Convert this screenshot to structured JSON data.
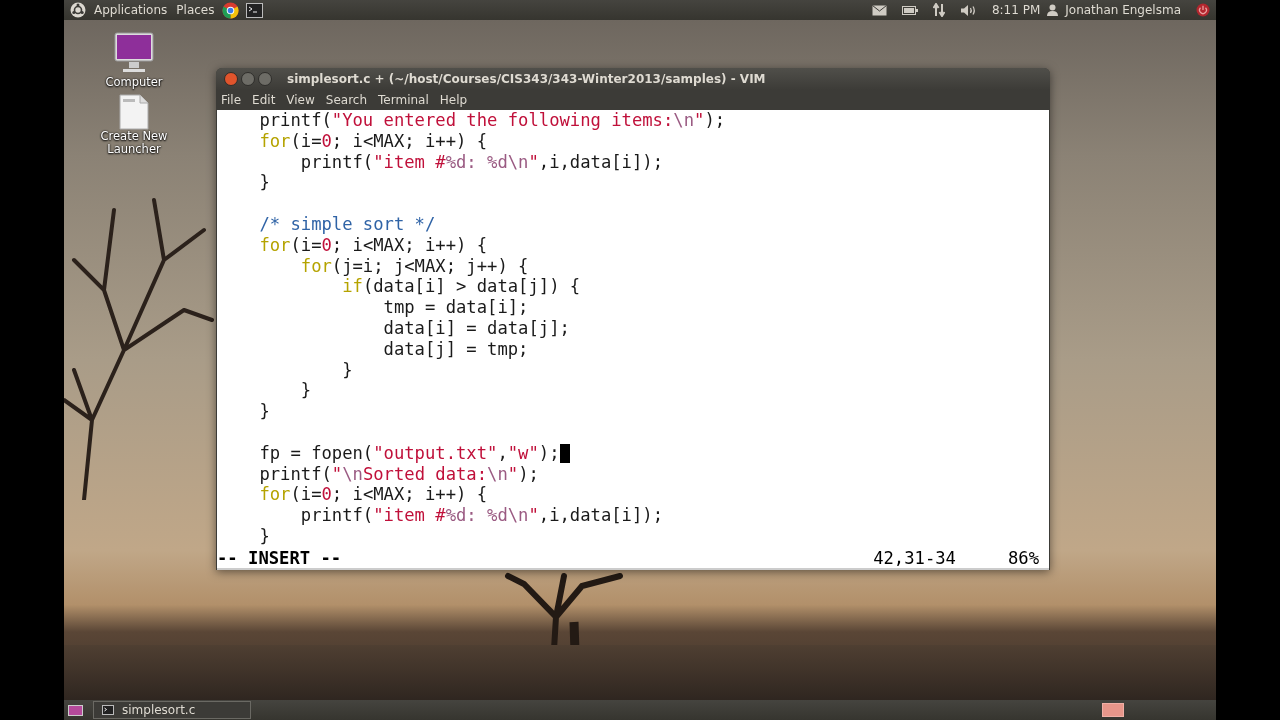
{
  "top_panel": {
    "menus": [
      "Applications",
      "Places"
    ],
    "clock": "8:11 PM",
    "user": "Jonathan Engelsma"
  },
  "desktop_icons": [
    {
      "kind": "computer",
      "label": "Computer"
    },
    {
      "kind": "launcher",
      "label": "Create New Launcher"
    }
  ],
  "window": {
    "title": "simplesort.c + (~/host/Courses/CIS343/343-Winter2013/samples) - VIM",
    "menu": [
      "File",
      "Edit",
      "View",
      "Search",
      "Terminal",
      "Help"
    ],
    "lines": [
      {
        "cursor": false,
        "tokens": [
          {
            "kind": "plain",
            "text": "    printf("
          },
          {
            "kind": "string",
            "text": "\"You entered the following items:"
          },
          {
            "kind": "special",
            "text": "\\n"
          },
          {
            "kind": "string",
            "text": "\""
          },
          {
            "kind": "plain",
            "text": ");"
          }
        ]
      },
      {
        "cursor": false,
        "tokens": [
          {
            "kind": "keyword",
            "text": "    for"
          },
          {
            "kind": "plain",
            "text": "(i="
          },
          {
            "kind": "number",
            "text": "0"
          },
          {
            "kind": "plain",
            "text": "; i<MAX; i++) {"
          }
        ]
      },
      {
        "cursor": false,
        "tokens": [
          {
            "kind": "plain",
            "text": "        printf("
          },
          {
            "kind": "string",
            "text": "\"item #"
          },
          {
            "kind": "special",
            "text": "%d: %d\\n"
          },
          {
            "kind": "string",
            "text": "\""
          },
          {
            "kind": "plain",
            "text": ",i,data[i]);"
          }
        ]
      },
      {
        "cursor": false,
        "tokens": [
          {
            "kind": "plain",
            "text": "    }"
          }
        ]
      },
      {
        "cursor": false
      },
      {
        "cursor": false,
        "tokens": [
          {
            "kind": "comment",
            "text": "    /* simple sort */"
          }
        ]
      },
      {
        "cursor": false,
        "tokens": [
          {
            "kind": "keyword",
            "text": "    for"
          },
          {
            "kind": "plain",
            "text": "(i="
          },
          {
            "kind": "number",
            "text": "0"
          },
          {
            "kind": "plain",
            "text": "; i<MAX; i++) {"
          }
        ]
      },
      {
        "cursor": false,
        "tokens": [
          {
            "kind": "keyword",
            "text": "        for"
          },
          {
            "kind": "plain",
            "text": "(j=i; j<MAX; j++) {"
          }
        ]
      },
      {
        "cursor": false,
        "tokens": [
          {
            "kind": "keyword",
            "text": "            if"
          },
          {
            "kind": "plain",
            "text": "(data[i] > data[j]) {"
          }
        ]
      },
      {
        "cursor": false,
        "tokens": [
          {
            "kind": "plain",
            "text": "                tmp = data[i];"
          }
        ]
      },
      {
        "cursor": false,
        "tokens": [
          {
            "kind": "plain",
            "text": "                data[i] = data[j];"
          }
        ]
      },
      {
        "cursor": false,
        "tokens": [
          {
            "kind": "plain",
            "text": "                data[j] = tmp;"
          }
        ]
      },
      {
        "cursor": false,
        "tokens": [
          {
            "kind": "plain",
            "text": "            }"
          }
        ]
      },
      {
        "cursor": false,
        "tokens": [
          {
            "kind": "plain",
            "text": "        }"
          }
        ]
      },
      {
        "cursor": false,
        "tokens": [
          {
            "kind": "plain",
            "text": "    }"
          }
        ]
      },
      {
        "cursor": false
      },
      {
        "cursor": true,
        "tokens": [
          {
            "kind": "plain",
            "text": "    fp = fopen("
          },
          {
            "kind": "string",
            "text": "\"output.txt\""
          },
          {
            "kind": "plain",
            "text": ","
          },
          {
            "kind": "string",
            "text": "\"w\""
          },
          {
            "kind": "plain",
            "text": ");"
          }
        ]
      },
      {
        "cursor": false,
        "tokens": [
          {
            "kind": "plain",
            "text": "    printf("
          },
          {
            "kind": "string",
            "text": "\""
          },
          {
            "kind": "special",
            "text": "\\n"
          },
          {
            "kind": "string",
            "text": "Sorted data:"
          },
          {
            "kind": "special",
            "text": "\\n"
          },
          {
            "kind": "string",
            "text": "\""
          },
          {
            "kind": "plain",
            "text": ");"
          }
        ]
      },
      {
        "cursor": false,
        "tokens": [
          {
            "kind": "keyword",
            "text": "    for"
          },
          {
            "kind": "plain",
            "text": "(i="
          },
          {
            "kind": "number",
            "text": "0"
          },
          {
            "kind": "plain",
            "text": "; i<MAX; i++) {"
          }
        ]
      },
      {
        "cursor": false,
        "tokens": [
          {
            "kind": "plain",
            "text": "        printf("
          },
          {
            "kind": "string",
            "text": "\"item #"
          },
          {
            "kind": "special",
            "text": "%d: %d\\n"
          },
          {
            "kind": "string",
            "text": "\""
          },
          {
            "kind": "plain",
            "text": ",i,data[i]);"
          }
        ]
      },
      {
        "cursor": false,
        "tokens": [
          {
            "kind": "plain",
            "text": "    }"
          }
        ]
      }
    ],
    "mode": "-- INSERT --",
    "position": "42,31-34",
    "scroll": "86%"
  },
  "taskbar": {
    "items": [
      {
        "label": "simplesort.c"
      }
    ]
  }
}
